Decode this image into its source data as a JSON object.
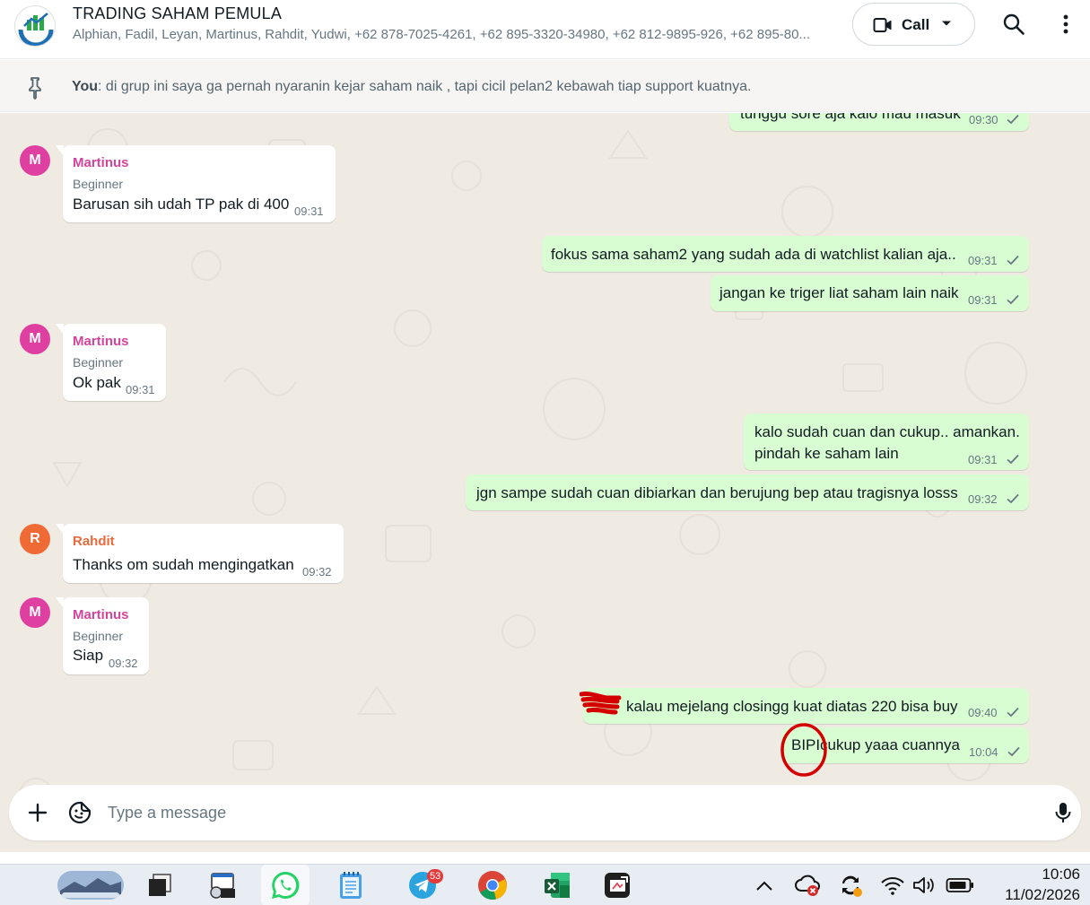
{
  "header": {
    "title": "TRADING SAHAM PEMULA",
    "members": "Alphian, Fadil, Leyan, Martinus, Rahdit, Yudwi, +62 878-7025-4261, +62 895-3320-34980, +62 812-9895-926, +62 895-80...",
    "call_label": "Call"
  },
  "pinned": {
    "author": "You",
    "text": ": di grup ini saya ga pernah nyaranin kejar saham naik , tapi cicil pelan2 kebawah tiap support kuatnya."
  },
  "messages": [
    {
      "dir": "out",
      "text": "tunggu sore aja kalo mau masuk",
      "time": "09:30"
    },
    {
      "dir": "in",
      "initial": "M",
      "sender": "Martinus",
      "role": "Beginner",
      "text": "Barusan sih udah TP pak di 400",
      "time": "09:31"
    },
    {
      "dir": "out",
      "text": "fokus sama saham2 yang sudah ada di watchlist kalian aja..",
      "time": "09:31"
    },
    {
      "dir": "out",
      "text": "jangan ke triger liat saham lain naik",
      "time": "09:31"
    },
    {
      "dir": "in",
      "initial": "M",
      "sender": "Martinus",
      "role": "Beginner",
      "text": "Ok pak",
      "time": "09:31"
    },
    {
      "dir": "out",
      "text_line1": "kalo sudah cuan dan cukup.. amankan.",
      "text_line2": "pindah ke saham lain",
      "time": "09:31"
    },
    {
      "dir": "out",
      "text": "jgn sampe sudah cuan dibiarkan dan berujung bep atau tragisnya losss",
      "time": "09:32"
    },
    {
      "dir": "in",
      "initial": "R",
      "sender": "Rahdit",
      "text": "Thanks om sudah mengingatkan",
      "time": "09:32"
    },
    {
      "dir": "in",
      "initial": "M",
      "sender": "Martinus",
      "role": "Beginner",
      "text": "Siap",
      "time": "09:32"
    },
    {
      "dir": "out",
      "text": "kalau mejelang closingg kuat diatas 220 bisa buy",
      "time": "09:40"
    },
    {
      "dir": "out",
      "ticker": "BIPI",
      "text": " cukup yaaa cuannya",
      "time": "10:04"
    }
  ],
  "composer": {
    "placeholder": "Type a message"
  },
  "taskbar": {
    "telegram_badge": "53",
    "time": "10:06",
    "date": "11/02/2026"
  },
  "colors": {
    "outgoing_bubble": "#d9fdd3",
    "incoming_bubble": "#ffffff",
    "chat_bg": "#efeae2",
    "martinus_name": "#d6449a",
    "rahdit_name": "#e8693a",
    "martinus_avatar": "#df3fa0",
    "rahdit_avatar": "#ef6a34",
    "annotation": "#d40000"
  }
}
